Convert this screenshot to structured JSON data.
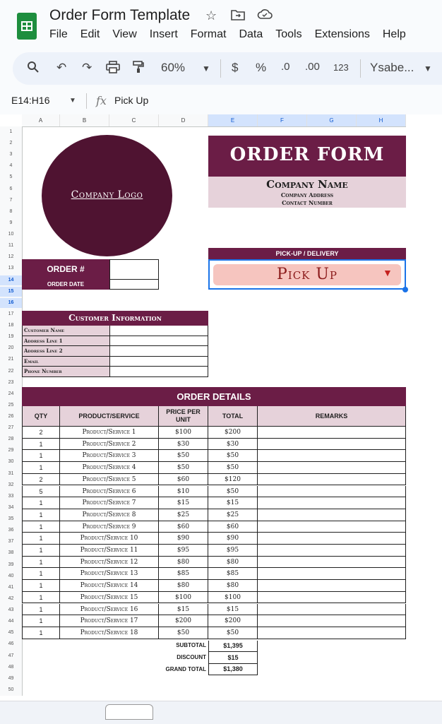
{
  "app": {
    "title": "Order Form Template",
    "menu": [
      "File",
      "Edit",
      "View",
      "Insert",
      "Format",
      "Data",
      "Tools",
      "Extensions",
      "Help"
    ]
  },
  "toolbar": {
    "zoom": "60%",
    "currency": "$",
    "percent": "%",
    "dec_less": ".0",
    "dec_more": ".00",
    "number_format": "123",
    "font": "Ysabe..."
  },
  "formula_bar": {
    "cell_ref": "E14:H16",
    "content": "Pick Up"
  },
  "columns": [
    "A",
    "B",
    "C",
    "D",
    "E",
    "F",
    "G",
    "H"
  ],
  "selected_columns": [
    "E",
    "F",
    "G",
    "H"
  ],
  "rows": [
    "1",
    "2",
    "3",
    "4",
    "5",
    "6",
    "7",
    "8",
    "9",
    "10",
    "11",
    "12",
    "13",
    "14",
    "15",
    "16",
    "17",
    "18",
    "19",
    "20",
    "21",
    "22",
    "23",
    "24",
    "25",
    "26",
    "27",
    "28",
    "29",
    "30",
    "31",
    "32",
    "33",
    "34",
    "35",
    "36",
    "37",
    "38",
    "39",
    "40",
    "41",
    "42",
    "43",
    "44",
    "45",
    "46",
    "47",
    "48",
    "49",
    "50"
  ],
  "selected_rows": [
    "14",
    "15",
    "16"
  ],
  "sheet": {
    "logo_text": "Company Logo",
    "form_title": "ORDER FORM",
    "company_name": "Company Name",
    "company_address": "Company Address",
    "contact_number": "Contact Number",
    "pickup_label": "PICK-UP / DELIVERY",
    "pickup_value": "Pick Up",
    "order_number_label": "ORDER #",
    "order_date_label": "ORDER DATE",
    "customer_info_title": "Customer Information",
    "customer_fields": [
      "Customer Name",
      "Address Line 1",
      "Address Line 2",
      "Email",
      "Phone Number"
    ],
    "order_details_title": "ORDER DETAILS",
    "headers": {
      "qty": "QTY",
      "product": "PRODUCT/SERVICE",
      "price": "PRICE PER UNIT",
      "total": "TOTAL",
      "remarks": "REMARKS"
    },
    "items": [
      {
        "qty": "2",
        "product": "Product/Service 1",
        "price": "$100",
        "total": "$200"
      },
      {
        "qty": "1",
        "product": "Product/Service 2",
        "price": "$30",
        "total": "$30"
      },
      {
        "qty": "1",
        "product": "Product/Service 3",
        "price": "$50",
        "total": "$50"
      },
      {
        "qty": "1",
        "product": "Product/Service 4",
        "price": "$50",
        "total": "$50"
      },
      {
        "qty": "2",
        "product": "Product/Service 5",
        "price": "$60",
        "total": "$120"
      },
      {
        "qty": "5",
        "product": "Product/Service 6",
        "price": "$10",
        "total": "$50"
      },
      {
        "qty": "1",
        "product": "Product/Service 7",
        "price": "$15",
        "total": "$15"
      },
      {
        "qty": "1",
        "product": "Product/Service 8",
        "price": "$25",
        "total": "$25"
      },
      {
        "qty": "1",
        "product": "Product/Service 9",
        "price": "$60",
        "total": "$60"
      },
      {
        "qty": "1",
        "product": "Product/Service 10",
        "price": "$90",
        "total": "$90"
      },
      {
        "qty": "1",
        "product": "Product/Service 11",
        "price": "$95",
        "total": "$95"
      },
      {
        "qty": "1",
        "product": "Product/Service 12",
        "price": "$80",
        "total": "$80"
      },
      {
        "qty": "1",
        "product": "Product/Service 13",
        "price": "$85",
        "total": "$85"
      },
      {
        "qty": "1",
        "product": "Product/Service 14",
        "price": "$80",
        "total": "$80"
      },
      {
        "qty": "1",
        "product": "Product/Service 15",
        "price": "$100",
        "total": "$100"
      },
      {
        "qty": "1",
        "product": "Product/Service 16",
        "price": "$15",
        "total": "$15"
      },
      {
        "qty": "1",
        "product": "Product/Service 17",
        "price": "$200",
        "total": "$200"
      },
      {
        "qty": "1",
        "product": "Product/Service 18",
        "price": "$50",
        "total": "$50"
      }
    ],
    "subtotal_label": "SUBTOTAL",
    "subtotal": "$1,395",
    "discount_label": "DISCOUNT",
    "discount": "$15",
    "grand_total_label": "GRAND TOTAL",
    "grand_total": "$1,380"
  },
  "colors": {
    "maroon": "#6b1d46",
    "logo": "#4f1331",
    "pink": "#e6d2da",
    "pickup_chip": "#f6c5bf",
    "selection": "#1a73e8"
  },
  "icons": [
    "sheets-logo-icon",
    "star-icon",
    "move-to-folder-icon",
    "cloud-status-icon",
    "search-icon",
    "undo-icon",
    "redo-icon",
    "print-icon",
    "paint-format-icon",
    "chevron-down-icon",
    "function-icon",
    "dropdown-arrow-icon"
  ]
}
